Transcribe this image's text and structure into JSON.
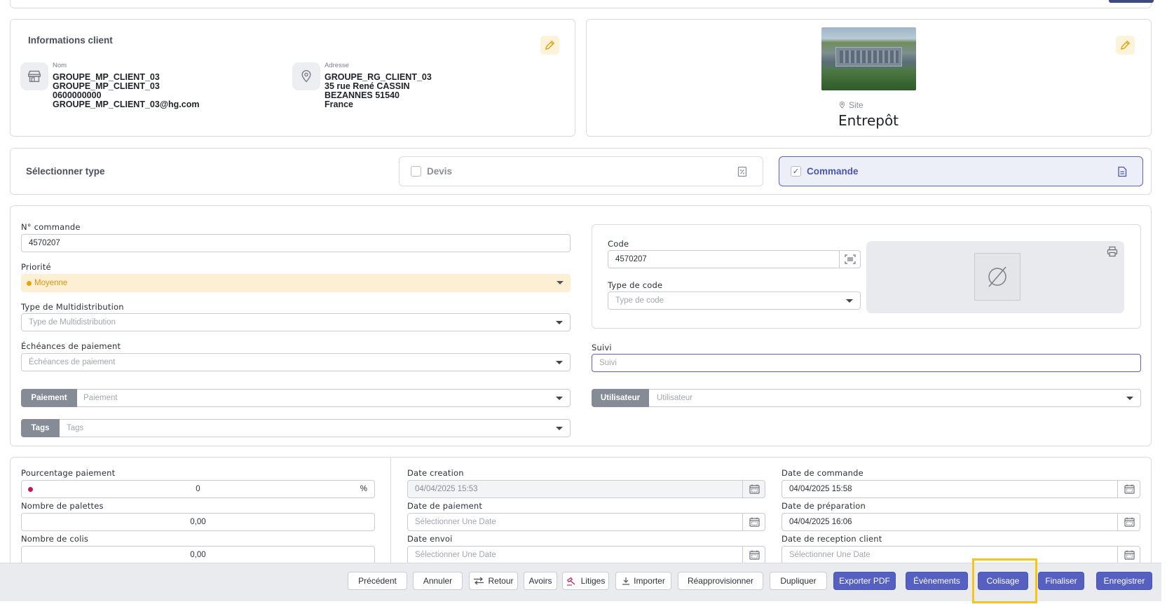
{
  "client": {
    "title": "Informations client",
    "name_label": "Nom",
    "name_lines": [
      "GROUPE_MP_CLIENT_03",
      "GROUPE_MP_CLIENT_03",
      "0600000000",
      "GROUPE_MP_CLIENT_03@hg.com"
    ],
    "address_label": "Adresse",
    "address_lines": [
      "GROUPE_RG_CLIENT_03",
      "35 rue René CASSIN",
      "BEZANNES 51540",
      "France"
    ]
  },
  "site": {
    "label": "Site",
    "name": "Entrepôt"
  },
  "type_select": {
    "title": "Sélectionner type",
    "options": [
      {
        "label": "Devis",
        "checked": false
      },
      {
        "label": "Commande",
        "checked": true
      }
    ]
  },
  "order": {
    "number_label": "N° commande",
    "number_value": "4570207",
    "priority_label": "Priorité",
    "priority_value": "Moyenne",
    "multidistrib_label": "Type de Multidistribution",
    "multidistrib_placeholder": "Type de Multidistribution",
    "echeances_label": "Échéances de paiement",
    "echeances_placeholder": "Échéances de paiement",
    "paiement_addon": "Paiement",
    "paiement_placeholder": "Paiement",
    "tags_addon": "Tags",
    "tags_placeholder": "Tags",
    "code_label": "Code",
    "code_value": "4570207",
    "code_type_label": "Type de code",
    "code_type_placeholder": "Type de code",
    "suivi_label": "Suivi",
    "suivi_placeholder": "Suivi",
    "utilisateur_addon": "Utilisateur",
    "utilisateur_placeholder": "Utilisateur"
  },
  "details": {
    "pourcentage_label": "Pourcentage paiement",
    "pourcentage_value": "0",
    "pourcentage_unit": "%",
    "palettes_label": "Nombre de palettes",
    "palettes_value": "0,00",
    "colis_label": "Nombre de colis",
    "colis_value": "0,00",
    "date_creation_label": "Date creation",
    "date_creation_value": "04/04/2025 15:53",
    "date_paiement_label": "Date de paiement",
    "date_paiement_placeholder": "Sélectionner Une Date",
    "date_envoi_label": "Date envoi",
    "date_envoi_placeholder": "Sélectionner Une Date",
    "date_commande_label": "Date de commande",
    "date_commande_value": "04/04/2025 15:58",
    "date_preparation_label": "Date de préparation",
    "date_preparation_value": "04/04/2025 16:06",
    "date_reception_label": "Date de reception client",
    "date_reception_placeholder": "Sélectionner Une Date"
  },
  "footer": {
    "precedent": "Précédent",
    "annuler": "Annuler",
    "retour": "Retour",
    "avoirs": "Avoirs",
    "litiges": "Litiges",
    "importer": "Importer",
    "reapprovisionner": "Réapprovisionner",
    "dupliquer": "Dupliquer",
    "exporter_pdf": "Exporter PDF",
    "evenements": "Évènements",
    "colisage": "Colisage",
    "finaliser": "Finaliser",
    "enregistrer": "Enregistrer"
  },
  "colors": {
    "primary": "#5560c0",
    "priority_bg": "#fcefd4",
    "priority_text": "#d99412",
    "edit_icon": "#e0a513",
    "highlight": "#f5c518",
    "pourcentage_dot": "#c2185b"
  }
}
